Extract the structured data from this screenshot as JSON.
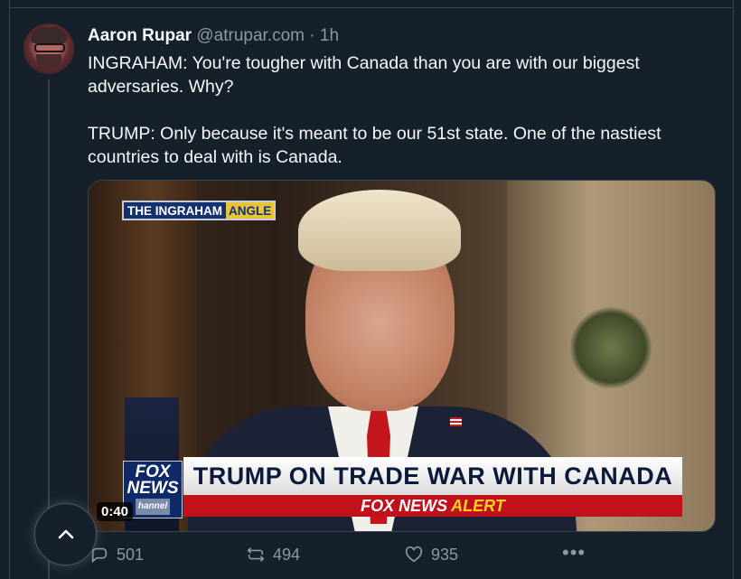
{
  "tweet": {
    "author_name": "Aaron Rupar",
    "handle": "@atrupar.com",
    "separator": "·",
    "time": "1h",
    "paragraphs": [
      "INGRAHAM: You're tougher with Canada than you are with our biggest adversaries. Why?",
      "TRUMP: Only because it's meant to be our 51st state. One of the nastiest countries to deal with is Canada."
    ]
  },
  "video": {
    "show_logo_part1": "THE INGRAHAM",
    "show_logo_part2": "ANGLE",
    "chyron": "TRUMP ON TRADE WAR WITH CANADA",
    "alert_network": "FOX NEWS",
    "alert_label": "ALERT",
    "fox_logo_line1": "FOX",
    "fox_logo_line2": "NEWS",
    "fox_logo_line3": "hannel",
    "duration": "0:40"
  },
  "actions": {
    "replies": "501",
    "reposts": "494",
    "likes": "935",
    "more": "•••"
  },
  "colors": {
    "background": "#15202b",
    "muted": "#8b98a5",
    "fox_red": "#c1121c",
    "alert_yellow": "#ffd21f"
  },
  "icons": [
    "reply-icon",
    "repost-icon",
    "like-icon",
    "more-icon",
    "chevron-up-icon"
  ]
}
